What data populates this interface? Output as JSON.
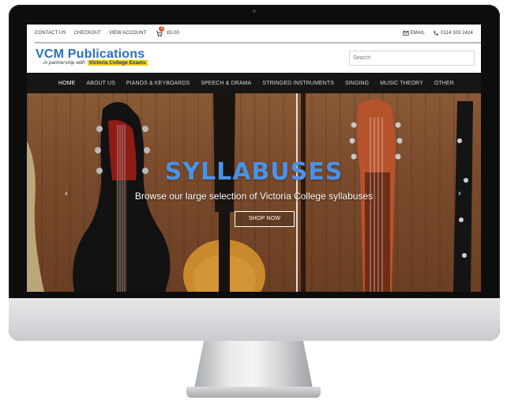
{
  "topbar": {
    "links": [
      "CONTACT US",
      "CHECKOUT",
      "VIEW ACCOUNT"
    ],
    "cart_count": "0",
    "cart_total": "£0.00",
    "email_label": "EMAIL",
    "phone": "0114 303 2424"
  },
  "header": {
    "logo_title": "VCM Publications",
    "logo_tagline": "in partnership with",
    "logo_partner": "Victoria College Exams",
    "search_placeholder": "Search"
  },
  "nav": {
    "items": [
      "HOME",
      "ABOUT US",
      "PIANOS & KEYBOARDS",
      "SPEECH & DRAMA",
      "STRINGED INSTRUMENTS",
      "SINGING",
      "MUSIC THEORY",
      "OTHER"
    ],
    "active_index": 0
  },
  "hero": {
    "title": "SYLLABUSES",
    "subtitle": "Browse our large selection of Victoria College syllabuses",
    "button_label": "SHOP NOW",
    "prev_glyph": "‹",
    "next_glyph": "›"
  },
  "colors": {
    "brand_blue": "#2a6fc4",
    "hero_title_blue": "#4a92e8",
    "nav_background": "#161616",
    "badge_yellow": "#f2cc1a"
  }
}
